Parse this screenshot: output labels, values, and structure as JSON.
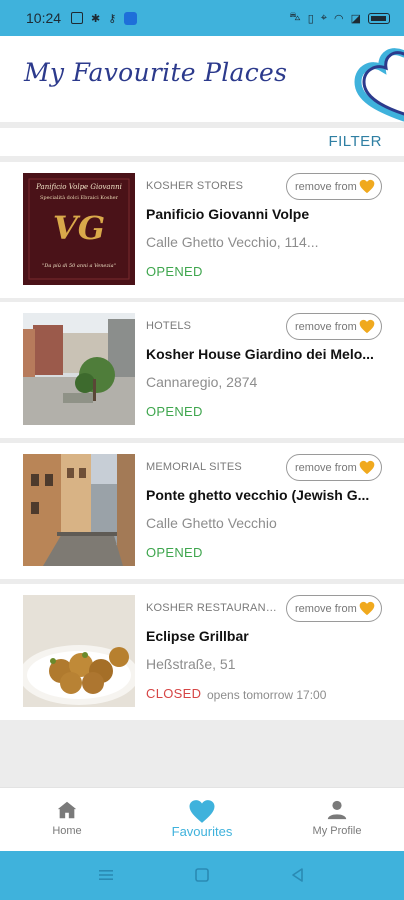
{
  "status_bar": {
    "time": "10:24"
  },
  "header": {
    "title": "My Favourite Places"
  },
  "filter": {
    "label": "FILTER"
  },
  "places": [
    {
      "category": "KOSHER STORES",
      "name": "Panificio Giovanni Volpe",
      "address": "Calle Ghetto Vecchio, 114...",
      "status": "OPENED",
      "status_type": "open",
      "hours": "",
      "remove_label": "remove from",
      "thumb": {
        "line1": "Panificio Volpe Giovanni",
        "line2": "Specialità dolci Ebraici Kosher",
        "monogram": "VG",
        "tagline": "\"Da più di 50 anni a Venezia\""
      }
    },
    {
      "category": "HOTELS",
      "name": "Kosher House Giardino dei Melo...",
      "address": "Cannaregio, 2874",
      "status": "OPENED",
      "status_type": "open",
      "hours": "",
      "remove_label": "remove from"
    },
    {
      "category": "MEMORIAL SITES",
      "name": "Ponte ghetto vecchio (Jewish G...",
      "address": "Calle Ghetto Vecchio",
      "status": "OPENED",
      "status_type": "open",
      "hours": "",
      "remove_label": "remove from"
    },
    {
      "category": "KOSHER RESTAURANTS...",
      "name": "Eclipse Grillbar",
      "address": "Heßstraße, 51",
      "status": "CLOSED",
      "status_type": "closed",
      "hours": "opens tomorrow 17:00",
      "remove_label": "remove from"
    }
  ],
  "nav": [
    {
      "label": "Home",
      "icon": "home-icon"
    },
    {
      "label": "Favourites",
      "icon": "heart-icon",
      "active": true
    },
    {
      "label": "My Profile",
      "icon": "person-icon"
    }
  ],
  "colors": {
    "accent": "#3fb2dc",
    "heart": "#f0a91e",
    "open": "#3fa64e",
    "closed": "#d64545",
    "title": "#2c3a8c"
  }
}
